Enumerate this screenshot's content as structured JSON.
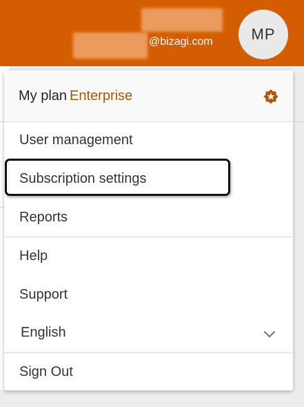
{
  "header": {
    "email_domain": "@bizagi.com",
    "avatar_initials": "MP",
    "brand_color": "#d35d00"
  },
  "menu": {
    "plan": {
      "label": "My plan",
      "name": "Enterprise",
      "icon": "settings-star-icon"
    },
    "items": [
      {
        "label": "User management"
      },
      {
        "label": "Subscription settings"
      },
      {
        "label": "Reports"
      },
      {
        "label": "Help"
      },
      {
        "label": "Support"
      },
      {
        "label": "English",
        "icon": "chevron-down-icon"
      },
      {
        "label": "Sign Out"
      }
    ]
  }
}
